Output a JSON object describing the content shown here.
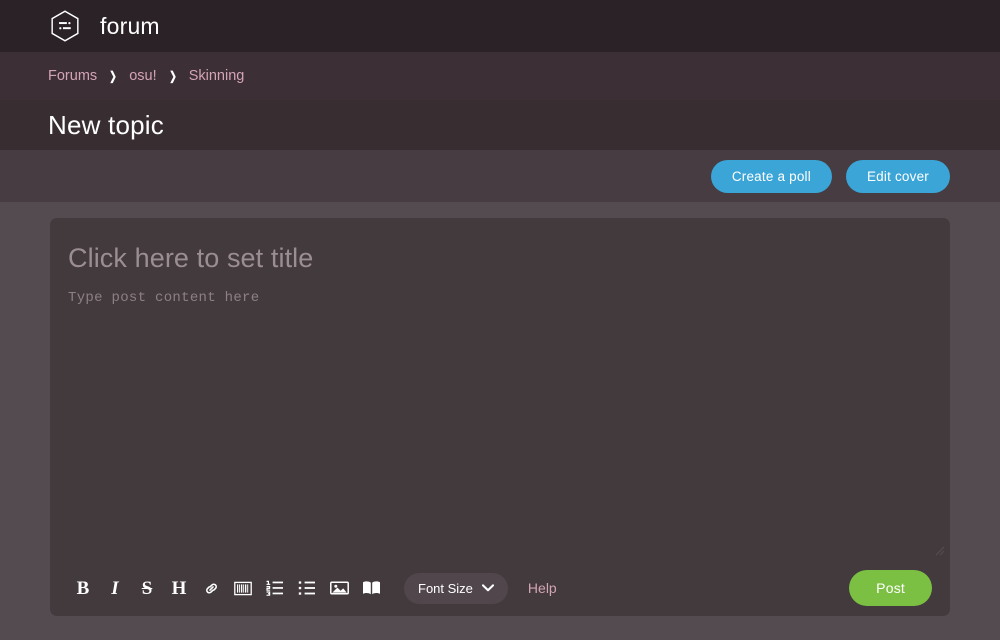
{
  "navbar": {
    "logo_icon": "forum-hexagon-icon",
    "brand": "forum"
  },
  "breadcrumb": {
    "separator": "❯",
    "items": [
      {
        "label": "Forums"
      },
      {
        "label": "osu!"
      },
      {
        "label": "Skinning"
      }
    ]
  },
  "header": {
    "page_title": "New topic"
  },
  "action_bar": {
    "create_poll_label": "Create a poll",
    "edit_cover_label": "Edit cover"
  },
  "editor": {
    "title_placeholder": "Click here to set title",
    "content_placeholder": "Type post content here",
    "resize_handle_icon": "resize-grip-icon"
  },
  "toolbar": {
    "buttons": [
      {
        "name": "bold",
        "glyph": "B",
        "icon": "bold-icon"
      },
      {
        "name": "italic",
        "glyph": "I",
        "icon": "italic-icon"
      },
      {
        "name": "strike",
        "glyph": "S",
        "icon": "strikethrough-icon"
      },
      {
        "name": "heading",
        "glyph": "H",
        "icon": "heading-icon"
      },
      {
        "name": "link",
        "glyph": "",
        "icon": "link-icon"
      },
      {
        "name": "spoiler",
        "glyph": "",
        "icon": "spoilerbox-icon"
      },
      {
        "name": "ordered-list",
        "glyph": "",
        "icon": "numbered-list-icon"
      },
      {
        "name": "bullet-list",
        "glyph": "",
        "icon": "bullet-list-icon"
      },
      {
        "name": "image",
        "glyph": "",
        "icon": "image-icon"
      },
      {
        "name": "beatmap",
        "glyph": "",
        "icon": "open-book-icon"
      }
    ],
    "font_size_label": "Font Size",
    "font_size_chevron_icon": "chevron-down-icon",
    "help_label": "Help",
    "post_label": "Post"
  },
  "colors": {
    "navbar_bg": "#2a2226",
    "breadcrumb_bg": "#3d2f36",
    "title_bar_bg": "#382e32",
    "action_bar_bg": "#463c41",
    "page_bg": "#544b50",
    "editor_bg": "#433a3e",
    "accent_blue": "#3aa5d6",
    "accent_green": "#7cc043",
    "accent_pink": "#d3a4b5"
  }
}
